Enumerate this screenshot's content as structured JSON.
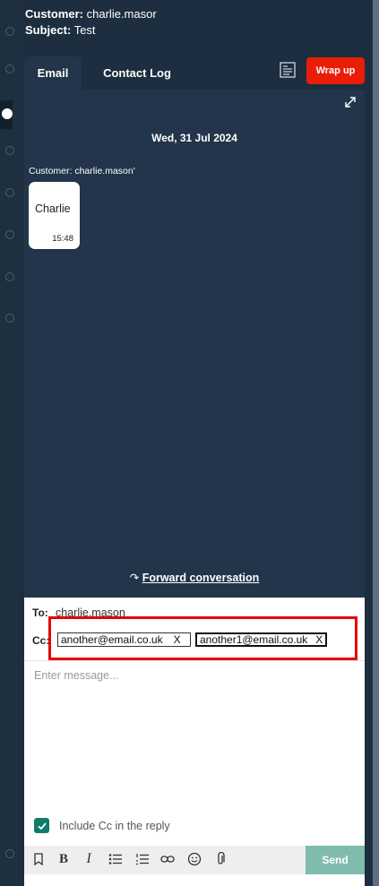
{
  "header": {
    "customer_label": "Customer:",
    "customer_value": "charlie.masor",
    "subject_label": "Subject:",
    "subject_value": "Test"
  },
  "tabs": [
    {
      "label": "Email",
      "active": true
    },
    {
      "label": "Contact Log",
      "active": false
    }
  ],
  "actions": {
    "notes_icon": "notes-icon",
    "wrap_up_label": "Wrap up",
    "wrap_up_color": "#e81e07"
  },
  "conversation": {
    "date": "Wed, 31 Jul 2024",
    "customer_label": "Customer: charlie.mason'",
    "message_text": "Charlie",
    "message_time": "15:48",
    "forward_label": "Forward conversation"
  },
  "compose": {
    "to_label": "To:",
    "to_value": "charlie.mason",
    "cc_label": "Cc:",
    "cc_chips": [
      {
        "email": "another@email.co.uk",
        "remove": "X"
      },
      {
        "email": "another1@email.co.uk",
        "remove": "X"
      }
    ],
    "message_placeholder": "Enter message...",
    "include_cc_label": "Include Cc in the reply",
    "include_cc_checked": true,
    "send_label": "Send"
  },
  "toolbar_icons": [
    "bookmark-icon",
    "bold-icon",
    "italic-icon",
    "bullet-list-icon",
    "numbered-list-icon",
    "link-icon",
    "emoji-icon",
    "attachment-icon"
  ],
  "colors": {
    "panel_background": "#1c2e3f",
    "conversation_background": "#22354a",
    "accent_green": "#0f7c6c",
    "send_button": "#7fbcad",
    "highlight_box": "#e60000"
  }
}
